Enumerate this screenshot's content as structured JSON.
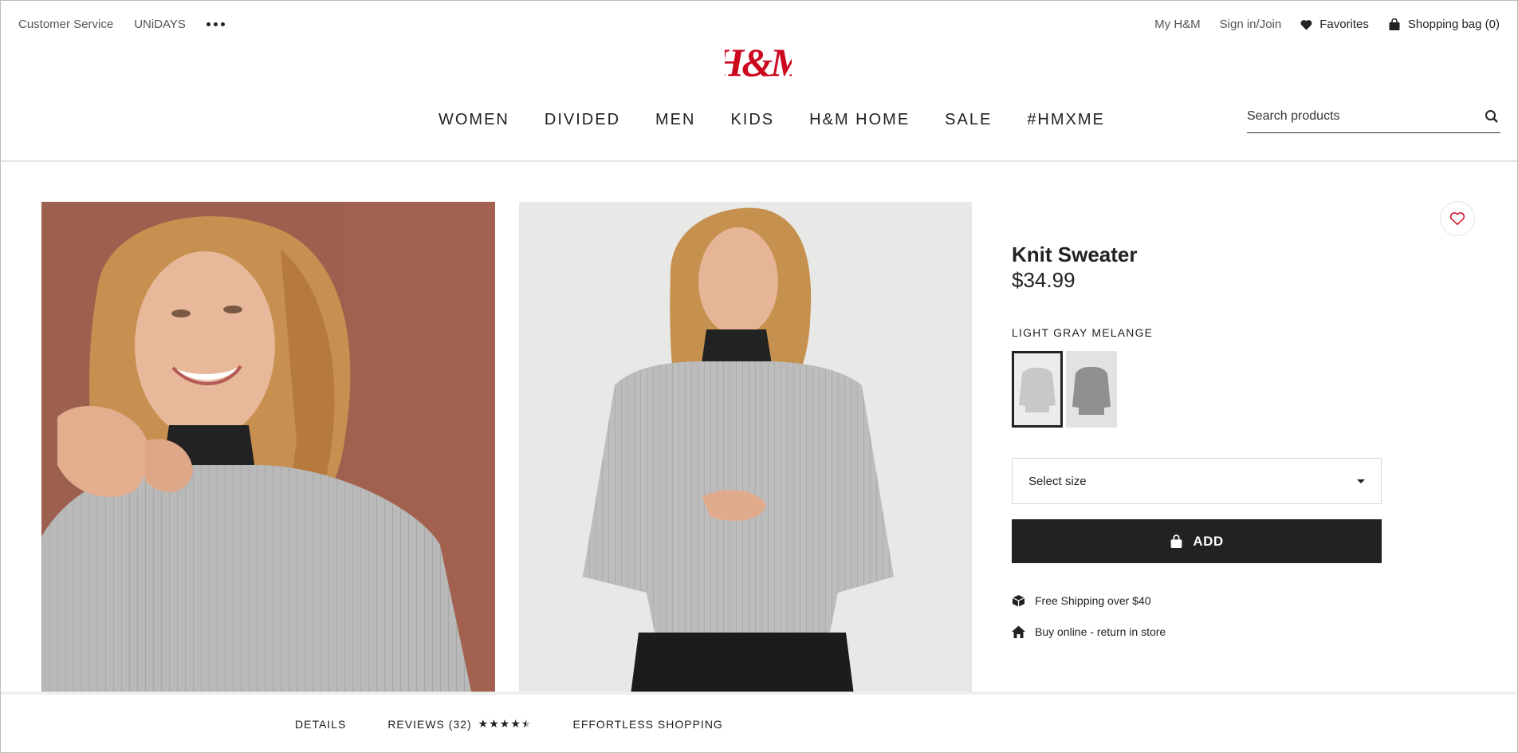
{
  "header": {
    "utility_left": [
      "Customer Service",
      "UNiDAYS"
    ],
    "more_icon": "more-dots-icon",
    "utility_right": {
      "my_hm": "My H&M",
      "sign_in": "Sign in/Join",
      "favorites": "Favorites",
      "shopping_bag": "Shopping bag (0)"
    },
    "logo_text": "H&M",
    "brand_color": "#cc071e",
    "nav": [
      "WOMEN",
      "DIVIDED",
      "MEN",
      "KIDS",
      "H&M HOME",
      "SALE",
      "#HMXME"
    ],
    "search": {
      "placeholder": "Search products"
    }
  },
  "product": {
    "title": "Knit Sweater",
    "price": "$34.99",
    "color_name": "LIGHT GRAY MELANGE",
    "swatches": [
      "light gray melange",
      "gray"
    ],
    "size_select": {
      "label": "Select size"
    },
    "add_button": "ADD",
    "perks": [
      "Free Shipping over $40",
      "Buy online - return in store"
    ]
  },
  "bottom_tabs": {
    "details": "DETAILS",
    "reviews": "REVIEWS (32)",
    "rating_stars": 4.5,
    "effortless": "EFFORTLESS SHOPPING"
  }
}
